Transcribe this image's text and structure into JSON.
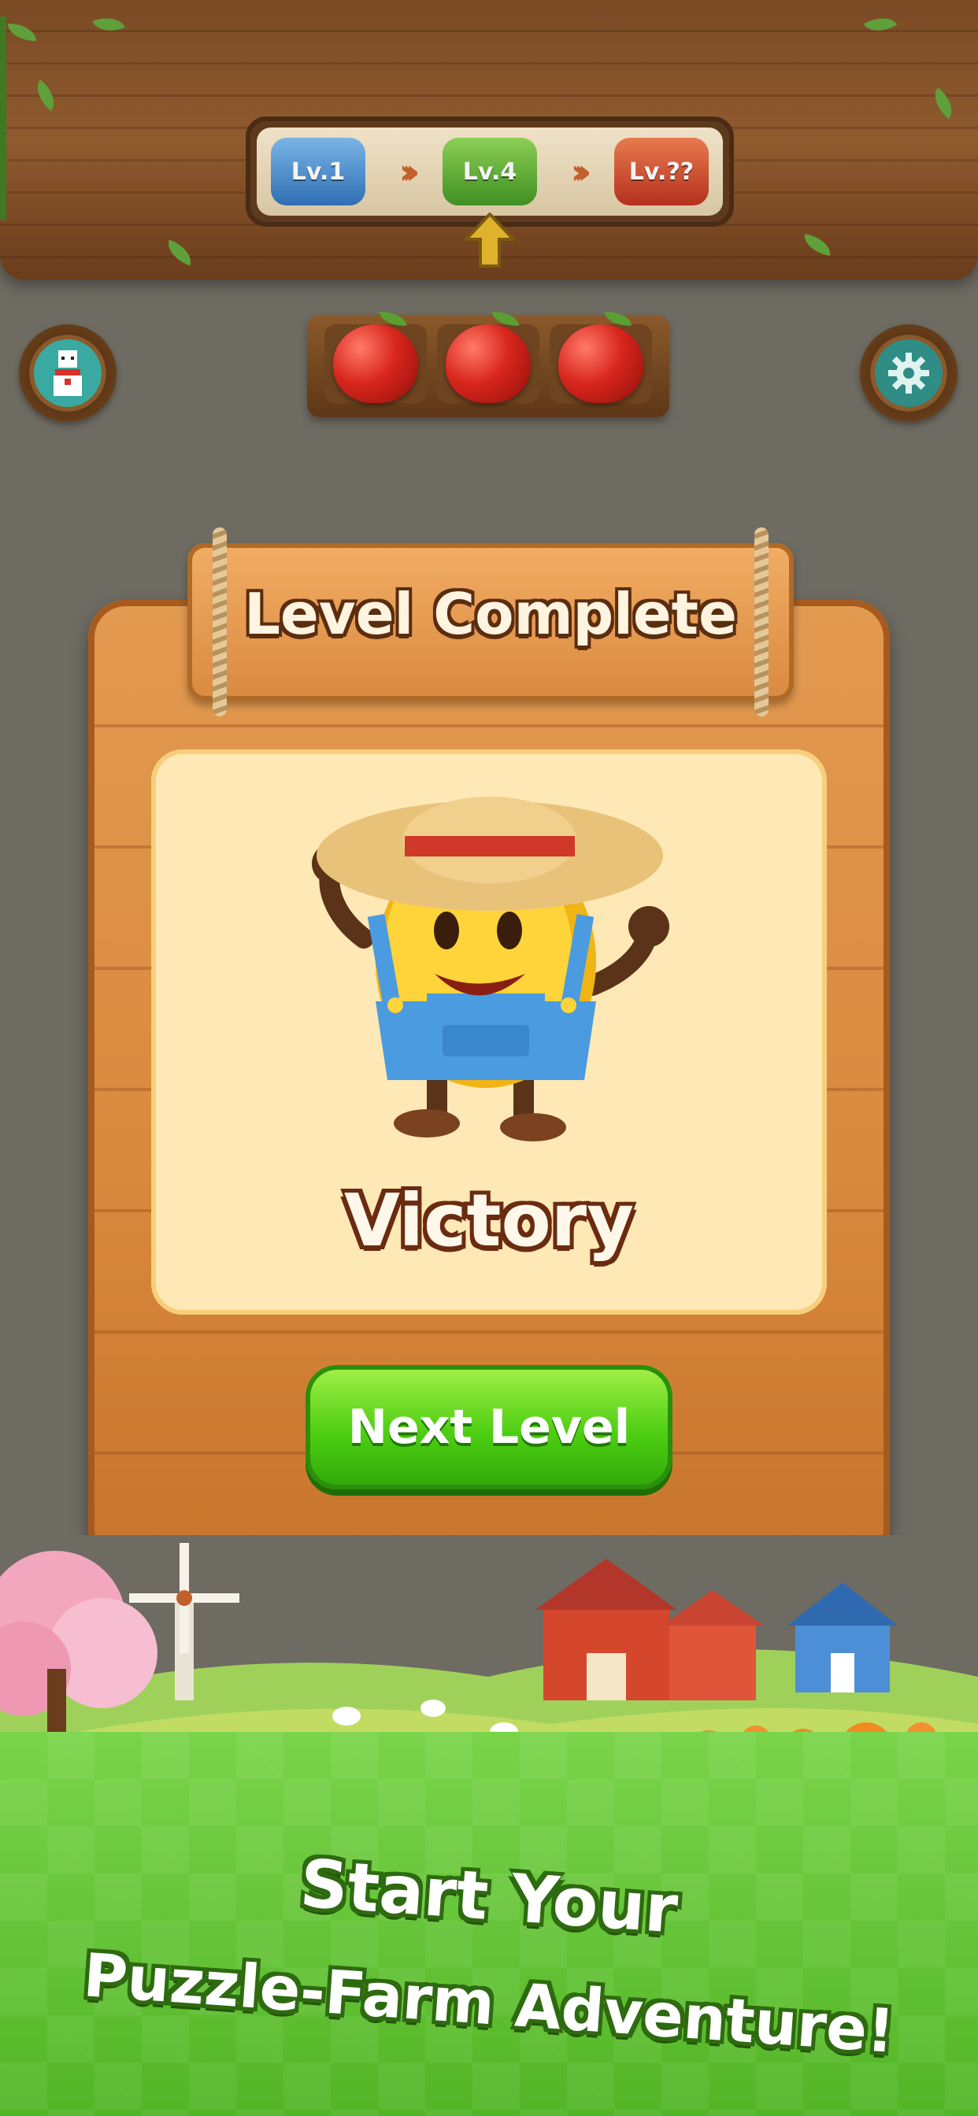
{
  "top_bar": {
    "levels": [
      {
        "label": "Lv.1",
        "color": "#2f6fb3"
      },
      {
        "label": "Lv.4",
        "color": "#3f8f22"
      },
      {
        "label": "Lv.??",
        "color": "#b4311e"
      }
    ],
    "current_marker_icon": "up-arrow-icon",
    "apples_collected": 3,
    "apples_total": 3
  },
  "buttons": {
    "left_icon": "avatar-icon",
    "right_icon": "gear-icon"
  },
  "dialog": {
    "title": "Level Complete",
    "result": "Victory",
    "next_button": "Next Level",
    "colors": {
      "wood": "#d9893e",
      "panel": "#fde8b6",
      "button": "#4dce12"
    }
  },
  "banner": {
    "line1": "Start Your",
    "line2": "Puzzle-Farm Adventure!"
  }
}
